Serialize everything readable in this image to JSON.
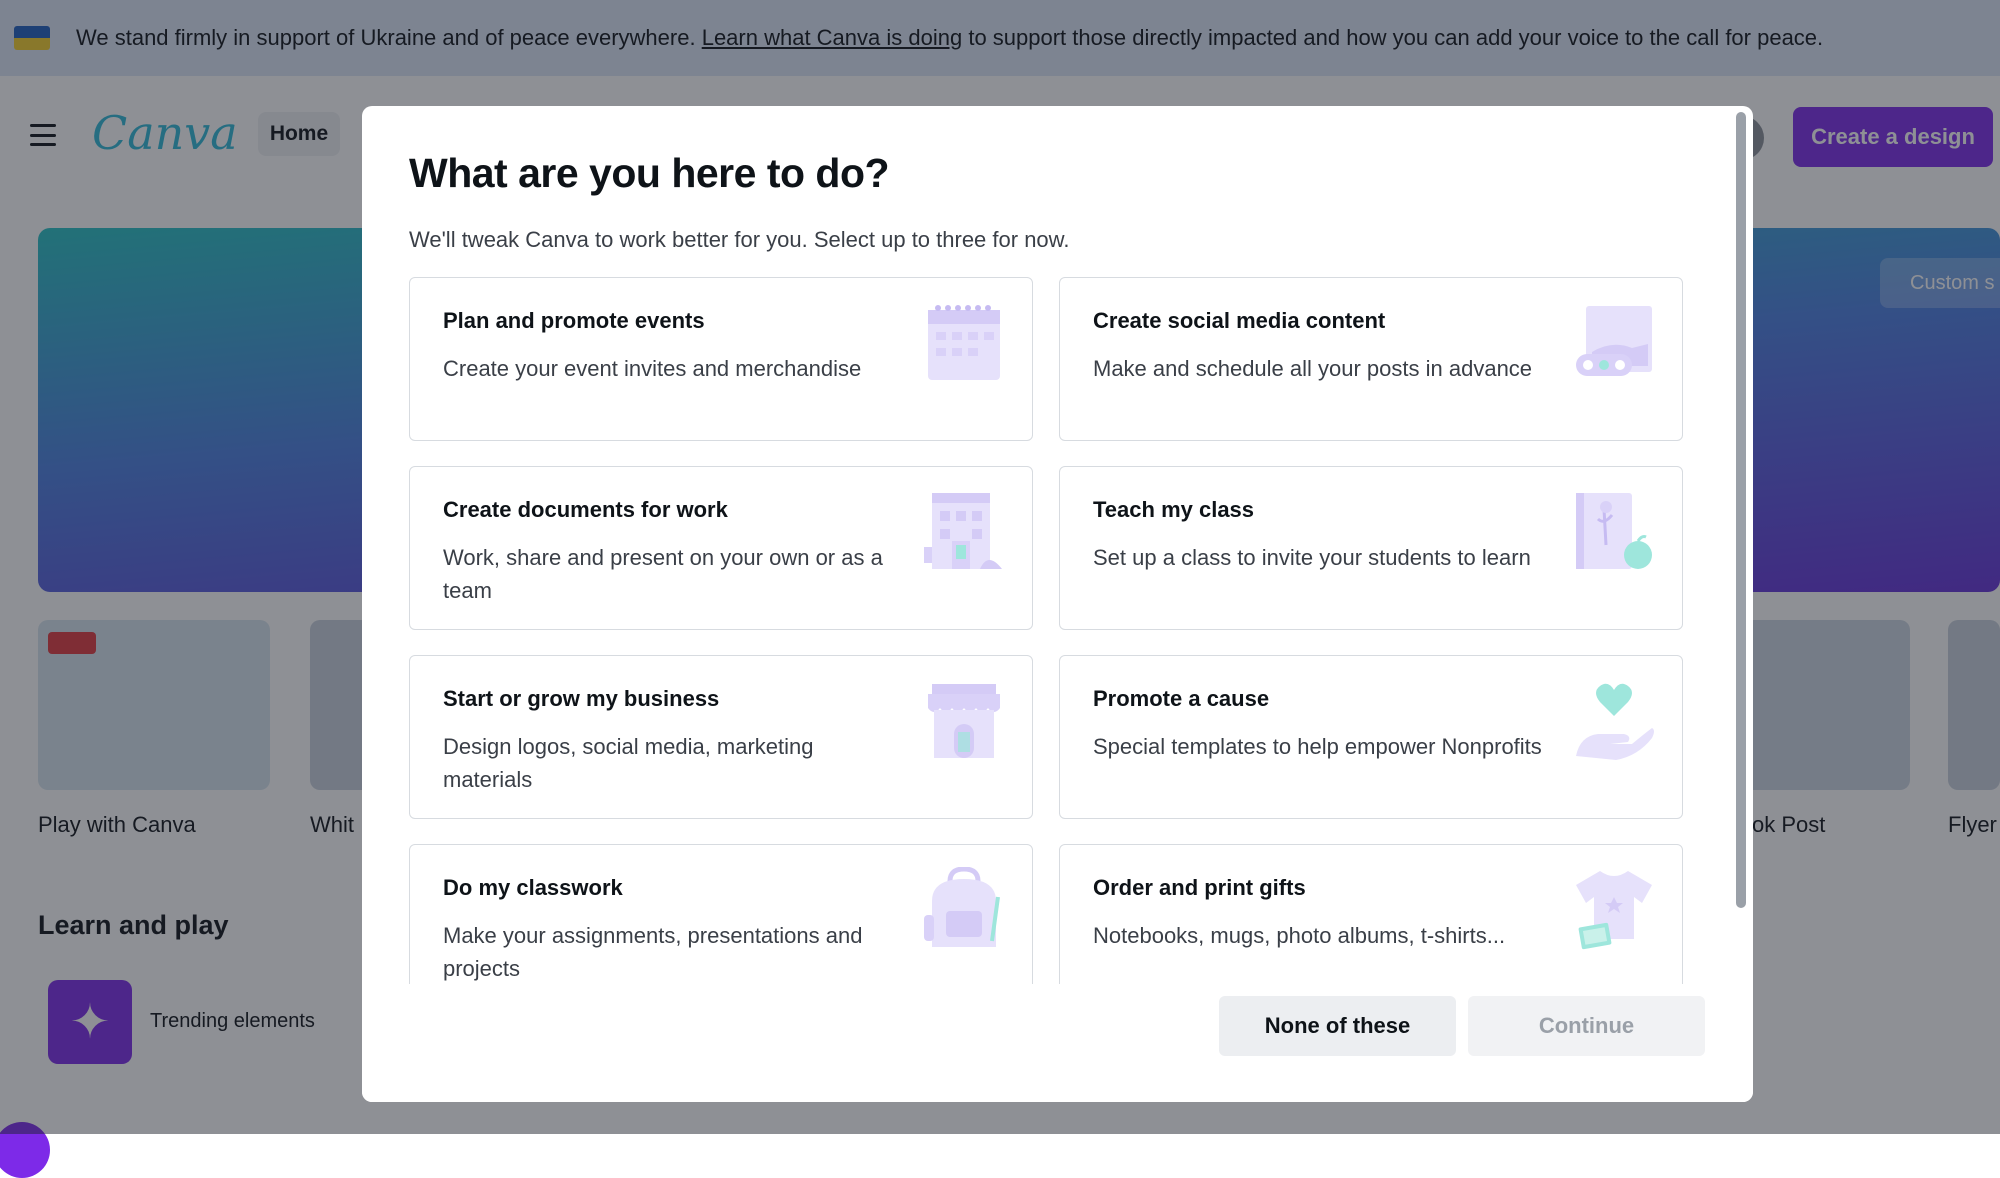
{
  "banner": {
    "text_before": "We stand firmly in support of Ukraine and of peace everywhere.",
    "link": "Learn what Canva is doing",
    "text_after": "to support those directly impacted and how you can add your voice to the call for peace."
  },
  "nav": {
    "logo": "Canva",
    "home": "Home",
    "create_button": "Create a design"
  },
  "hero": {
    "button": "Custom s"
  },
  "shortcuts": [
    "Play with Canva",
    "Whit",
    "ok Post",
    "Flyer"
  ],
  "learn": {
    "title": "Learn and play",
    "item": "Trending elements"
  },
  "modal": {
    "title": "What are you here to do?",
    "subtitle": "We'll tweak Canva to work better for you. Select up to three for now.",
    "cards": [
      {
        "title": "Plan and promote events",
        "desc": "Create your event invites and merchandise",
        "icon": "calendar-icon"
      },
      {
        "title": "Create social media content",
        "desc": "Make and schedule all your posts in advance",
        "icon": "social-post-icon"
      },
      {
        "title": "Create documents for work",
        "desc": "Work, share and present on your own or as a team",
        "icon": "office-building-icon"
      },
      {
        "title": "Teach my class",
        "desc": "Set up a class to invite your students to learn",
        "icon": "book-apple-icon"
      },
      {
        "title": "Start or grow my business",
        "desc": "Design logos, social media, marketing materials",
        "icon": "storefront-icon"
      },
      {
        "title": "Promote a cause",
        "desc": "Special templates to help empower Nonprofits",
        "icon": "heart-hand-icon"
      },
      {
        "title": "Do my classwork",
        "desc": "Make your assignments, presentations and projects",
        "icon": "backpack-icon"
      },
      {
        "title": "Order and print gifts",
        "desc": "Notebooks, mugs, photo albums, t-shirts...",
        "icon": "tshirt-icon"
      }
    ],
    "buttons": {
      "none": "None of these",
      "continue": "Continue"
    }
  },
  "colors": {
    "accent": "#7d2ae8",
    "illustration": "#e6e1fb",
    "illustration_accent": "#9ee6dc"
  }
}
